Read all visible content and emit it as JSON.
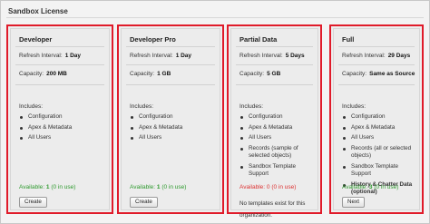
{
  "section_title": "Sandbox License",
  "labels": {
    "refresh": "Refresh Interval:",
    "capacity": "Capacity:",
    "includes": "Includes:",
    "available": "Available:"
  },
  "cards": [
    {
      "name": "Developer",
      "refresh": "1 Day",
      "capacity": "200 MB",
      "includes": [
        "Configuration",
        "Apex & Metadata",
        "All Users"
      ],
      "available": "1",
      "in_use": "(0 in use)",
      "button": "Create"
    },
    {
      "name": "Developer Pro",
      "refresh": "1 Day",
      "capacity": "1 GB",
      "includes": [
        "Configuration",
        "Apex & Metadata",
        "All Users"
      ],
      "available": "1",
      "in_use": "(0 in use)",
      "button": "Create"
    },
    {
      "name": "Partial Data",
      "refresh": "5 Days",
      "capacity": "5 GB",
      "includes": [
        "Configuration",
        "Apex & Metadata",
        "All Users",
        "Records (sample of selected objects)",
        "Sandbox Template Support"
      ],
      "available": "0",
      "in_use": "(0 in use)",
      "note": "No templates exist for this organization."
    },
    {
      "name": "Full",
      "refresh": "29 Days",
      "capacity": "Same as Source",
      "includes": [
        "Configuration",
        "Apex & Metadata",
        "All Users",
        "Records (all or selected objects)",
        "Sandbox Template Support",
        "History & Chatter Data (optional)"
      ],
      "available": "3",
      "in_use": "(0 in use)",
      "button": "Next"
    }
  ]
}
